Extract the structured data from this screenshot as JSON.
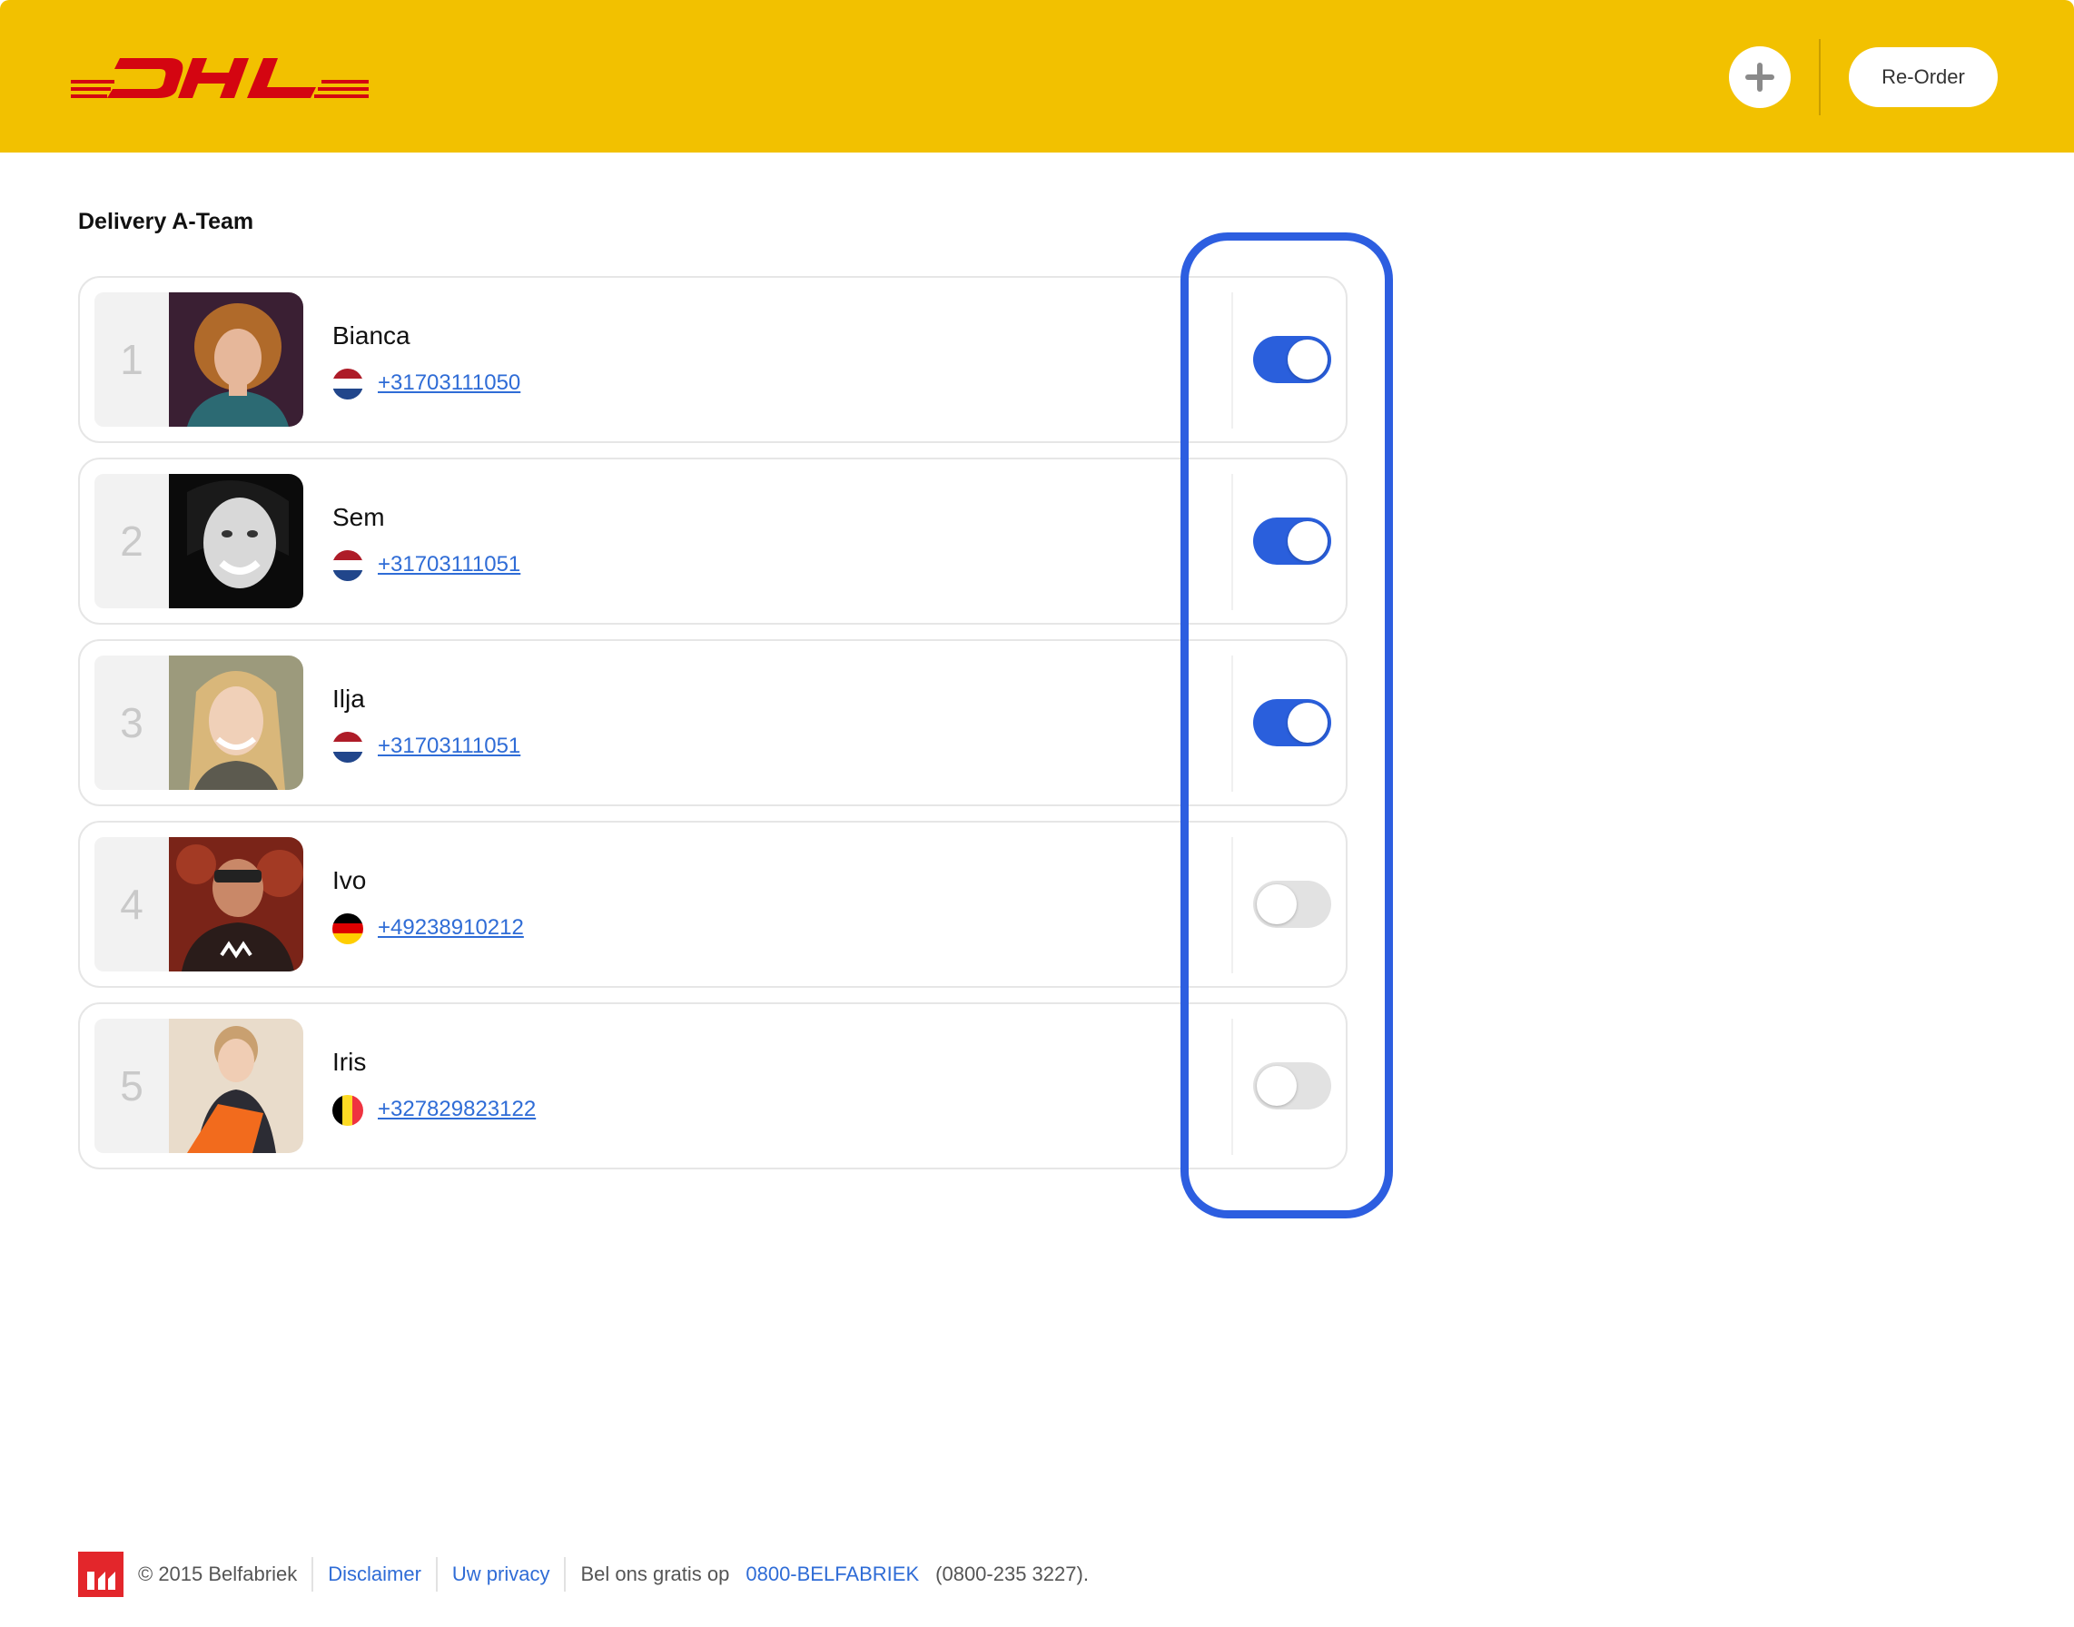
{
  "header": {
    "brand": "DHL",
    "add_icon": "plus-icon",
    "reorder_label": "Re-Order",
    "colors": {
      "background": "#f2c100",
      "logo": "#d40511"
    }
  },
  "section": {
    "title": "Delivery A-Team"
  },
  "team": [
    {
      "rank": "1",
      "name": "Bianca",
      "phone": "+31703111050",
      "flag": "netherlands-flag-icon",
      "enabled": true
    },
    {
      "rank": "2",
      "name": "Sem",
      "phone": "+31703111051",
      "flag": "netherlands-flag-icon",
      "enabled": true
    },
    {
      "rank": "3",
      "name": "Ilja",
      "phone": "+31703111051",
      "flag": "netherlands-flag-icon",
      "enabled": true
    },
    {
      "rank": "4",
      "name": "Ivo",
      "phone": "+49238910212",
      "flag": "germany-flag-icon",
      "enabled": false
    },
    {
      "rank": "5",
      "name": "Iris",
      "phone": "+327829823122",
      "flag": "belgium-flag-icon",
      "enabled": false
    }
  ],
  "footer": {
    "copyright": "© 2015 Belfabriek",
    "disclaimer": "Disclaimer",
    "privacy": "Uw privacy",
    "call_text": "Bel ons gratis op",
    "phone_link": "0800-BELFABRIEK",
    "phone_number": "(0800-235 3227)."
  },
  "colors": {
    "toggle_on": "#2a5fdc",
    "toggle_off": "#e2e2e2",
    "link": "#2f6cd6",
    "highlight": "#2d5ee0"
  }
}
